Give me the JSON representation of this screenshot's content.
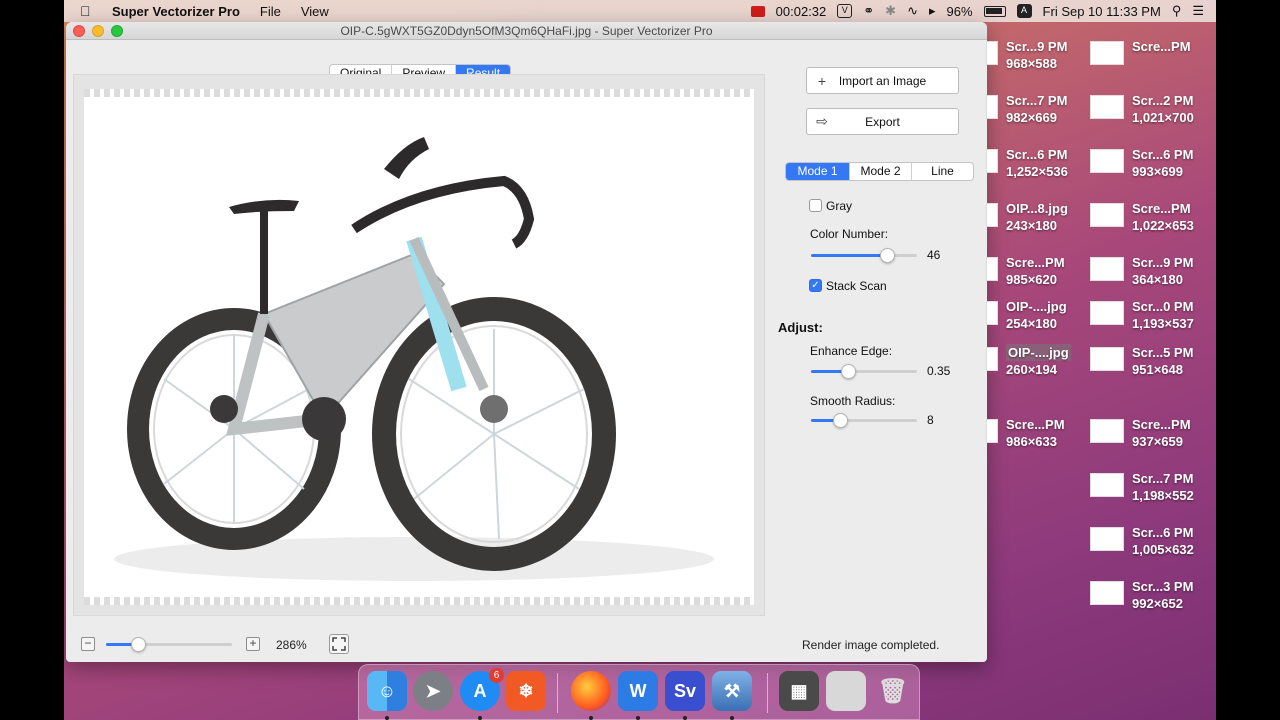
{
  "menubar": {
    "app_name": "Super Vectorizer Pro",
    "menus": [
      "File",
      "View"
    ],
    "recording_time": "00:02:32",
    "battery": "96%",
    "input_source": "A",
    "datetime": "Fri Sep 10  11:33 PM"
  },
  "window": {
    "title": "OIP-C.5gWXT5GZ0Ddyn5OfM3Qm6QHaFi.jpg - Super Vectorizer Pro",
    "view_tabs": [
      "Original",
      "Preview",
      "Result"
    ],
    "active_view_tab": "Result",
    "import_label": "Import an Image",
    "export_label": "Export",
    "mode_tabs": [
      "Mode 1",
      "Mode 2",
      "Line"
    ],
    "active_mode_tab": "Mode 1",
    "gray_label": "Gray",
    "gray_checked": false,
    "color_number_label": "Color Number:",
    "color_number_value": "46",
    "color_number_fraction": 0.72,
    "stack_scan_label": "Stack Scan",
    "stack_scan_checked": true,
    "adjust_heading": "Adjust:",
    "enhance_edge_label": "Enhance Edge:",
    "enhance_edge_value": "0.35",
    "enhance_edge_fraction": 0.35,
    "smooth_radius_label": "Smooth Radius:",
    "smooth_radius_value": "8",
    "smooth_radius_fraction": 0.27,
    "zoom_level": "286%",
    "zoom_fraction": 0.25,
    "status": "Render image completed."
  },
  "desktop_files": [
    {
      "name": "Scr...9 PM",
      "dims": "968×588"
    },
    {
      "name": "Scre...PM",
      "dims": ""
    },
    {
      "name": "Scr...7 PM",
      "dims": "982×669"
    },
    {
      "name": "Scr...2 PM",
      "dims": "1,021×700"
    },
    {
      "name": "Scr...6 PM",
      "dims": "1,252×536"
    },
    {
      "name": "Scr...6 PM",
      "dims": "993×699"
    },
    {
      "name": "OIP...8.jpg",
      "dims": "243×180"
    },
    {
      "name": "Scre...PM",
      "dims": "1,022×653"
    },
    {
      "name": "Scre...PM",
      "dims": "985×620"
    },
    {
      "name": "Scr...9 PM",
      "dims": "364×180"
    },
    {
      "name": "OIP-....jpg",
      "dims": "254×180"
    },
    {
      "name": "Scr...0 PM",
      "dims": "1,193×537"
    },
    {
      "name": "OIP-....jpg",
      "dims": "260×194"
    },
    {
      "name": "Scr...5 PM",
      "dims": "951×648"
    },
    {
      "name": "Scre...PM",
      "dims": "986×633"
    },
    {
      "name": "Scre...PM",
      "dims": "937×659"
    },
    {
      "name": "Scr...7 PM",
      "dims": "1,198×552"
    },
    {
      "name": "Scr...6 PM",
      "dims": "1,005×632"
    },
    {
      "name": "Scr...3 PM",
      "dims": "992×652"
    }
  ],
  "dock": {
    "app_store_badge": "6",
    "vectorizer_label": "Sv",
    "wps_label": "W"
  },
  "colors": {
    "accent": "#3478f6",
    "desktop_top": "#d98a58",
    "desktop_bottom": "#7a2f72"
  }
}
